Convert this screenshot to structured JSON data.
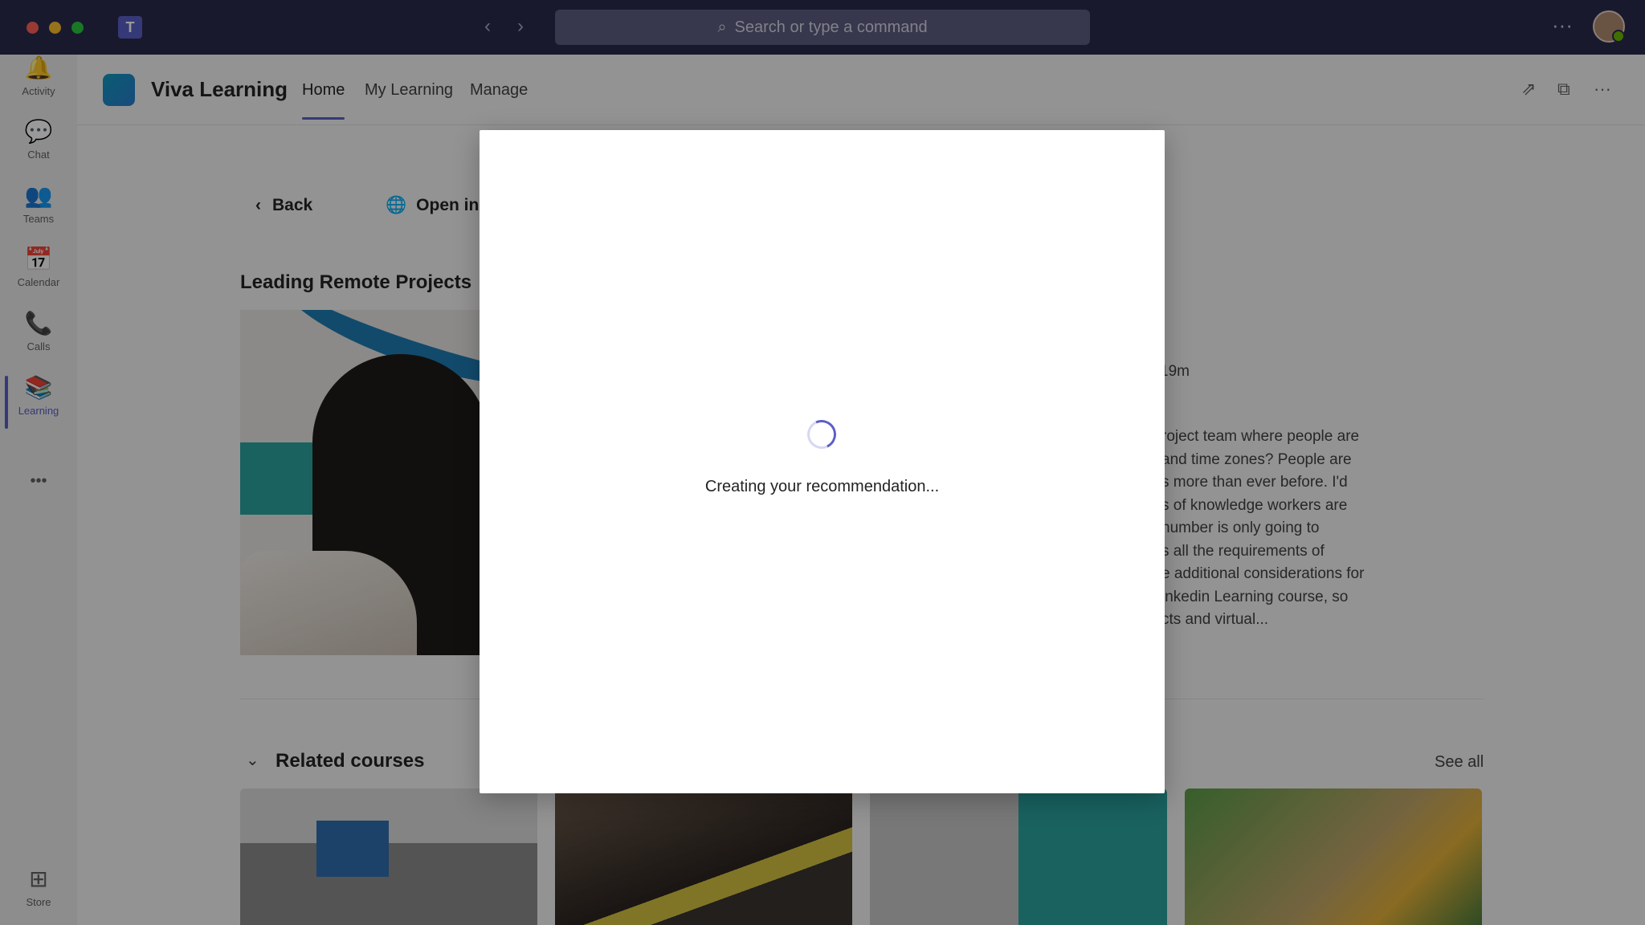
{
  "titlebar": {
    "app_icon": "teams-logo",
    "app_icon_glyph": "T",
    "search_placeholder": "Search or type a command",
    "more_glyph": "···"
  },
  "rail": {
    "items": [
      {
        "label": "Activity",
        "icon": "bell-icon",
        "glyph": "🔔"
      },
      {
        "label": "Chat",
        "icon": "chat-icon",
        "glyph": "💬"
      },
      {
        "label": "Teams",
        "icon": "teams-icon",
        "glyph": "👥"
      },
      {
        "label": "Calendar",
        "icon": "calendar-icon",
        "glyph": "📅"
      },
      {
        "label": "Calls",
        "icon": "phone-icon",
        "glyph": "📞"
      },
      {
        "label": "Learning",
        "icon": "learning-icon",
        "glyph": "📚"
      }
    ],
    "more_glyph": "•••",
    "store_label": "Store",
    "store_glyph": "⊞"
  },
  "app": {
    "name": "Viva Learning",
    "tabs": [
      "Home",
      "My Learning",
      "Manage"
    ],
    "active_tab": "Home"
  },
  "course": {
    "back_label": "Back",
    "open_label": "Open in l",
    "title": "Leading Remote Projects",
    "duration_fragment": "19m",
    "description_fragment": "roject team where people are\nand time zones? People are\ns more than ever before. I'd\ns of knowledge workers are\nnumber is only going to\ns all the requirements of\ne additional considerations for\ninkedin Learning course, so\ncts and virtual..."
  },
  "related": {
    "title": "Related courses",
    "see_all_label": "See all"
  },
  "dialog": {
    "loading_text": "Creating your recommendation..."
  },
  "colors": {
    "titlebar": "#2b2b4d",
    "accent": "#5b5fc7",
    "presence": "#6bb700"
  }
}
